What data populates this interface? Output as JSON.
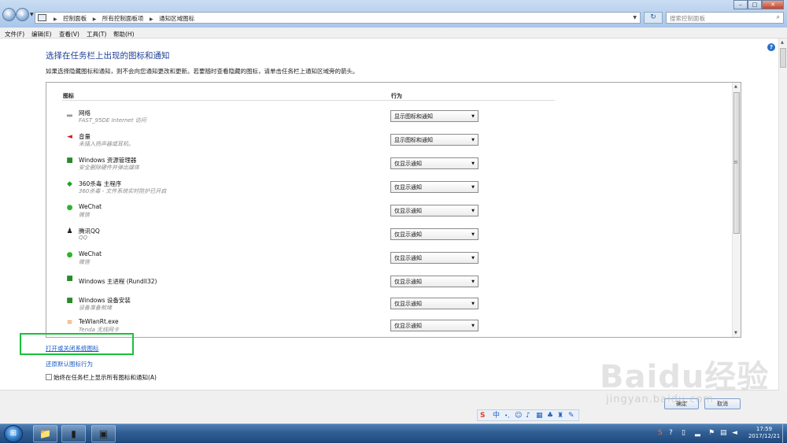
{
  "window": {
    "breadcrumbs": [
      "控制面板",
      "所有控制面板项",
      "通知区域图标"
    ],
    "search_placeholder": "搜索控制面板",
    "controls": {
      "minimize": "–",
      "maximize": "□",
      "close": "✕"
    }
  },
  "menu": [
    "文件(F)",
    "编辑(E)",
    "查看(V)",
    "工具(T)",
    "帮助(H)"
  ],
  "main": {
    "title": "选择在任务栏上出现的图标和通知",
    "description": "如果选择隐藏图标和通知，则不会向您通知更改和更新。若要随时查看隐藏的图标，请单击任务栏上通知区域旁的箭头。",
    "columns": {
      "icons": "图标",
      "behavior": "行为"
    },
    "rows": [
      {
        "name": "网络",
        "desc": "FAST_95DE Internet 访问",
        "behavior": "显示图标和通知",
        "icon": "network-icon"
      },
      {
        "name": "音量",
        "desc": "未插入扬声器或耳机。",
        "behavior": "显示图标和通知",
        "icon": "volume-icon"
      },
      {
        "name": "Windows 资源管理器",
        "desc": "安全删除硬件并弹出媒体",
        "behavior": "仅显示通知",
        "icon": "safely-remove-icon"
      },
      {
        "name": "360杀毒 主程序",
        "desc": "360杀毒 - 文件系统实时防护已开启",
        "behavior": "仅显示通知",
        "icon": "shield-icon"
      },
      {
        "name": "WeChat",
        "desc": "微信",
        "behavior": "仅显示通知",
        "icon": "wechat-icon"
      },
      {
        "name": "腾讯QQ",
        "desc": "QQ",
        "behavior": "仅显示通知",
        "icon": "qq-icon"
      },
      {
        "name": "WeChat",
        "desc": "微信",
        "behavior": "仅显示通知",
        "icon": "wechat-icon"
      },
      {
        "name": "Windows 主进程 (Rundll32)",
        "desc": "",
        "behavior": "仅显示通知",
        "icon": "rundll-icon"
      },
      {
        "name": "Windows 设备安装",
        "desc": "设备准备就绪",
        "behavior": "仅显示通知",
        "icon": "device-install-icon"
      },
      {
        "name": "TeWlanRt.exe",
        "desc": "Tenda 无线网卡",
        "behavior": "仅显示通知",
        "icon": "wifi-icon"
      }
    ],
    "link_toggle_system_icons": "打开或关闭系统图标",
    "link_restore_defaults": "还原默认图标行为",
    "always_show_label": "始终在任务栏上显示所有图标和通知(A)",
    "always_show_checked": false
  },
  "footer": {
    "ok": "确定",
    "cancel": "取消"
  },
  "watermark": {
    "text": "Baidu经验",
    "sub": "jingyan.baidu.com"
  },
  "taskbar": {
    "time": "17:59",
    "date": "2017/12/21"
  },
  "colors": {
    "highlight_box": "#18c23a",
    "link": "#1c5bc5",
    "title": "#1e3f93"
  }
}
